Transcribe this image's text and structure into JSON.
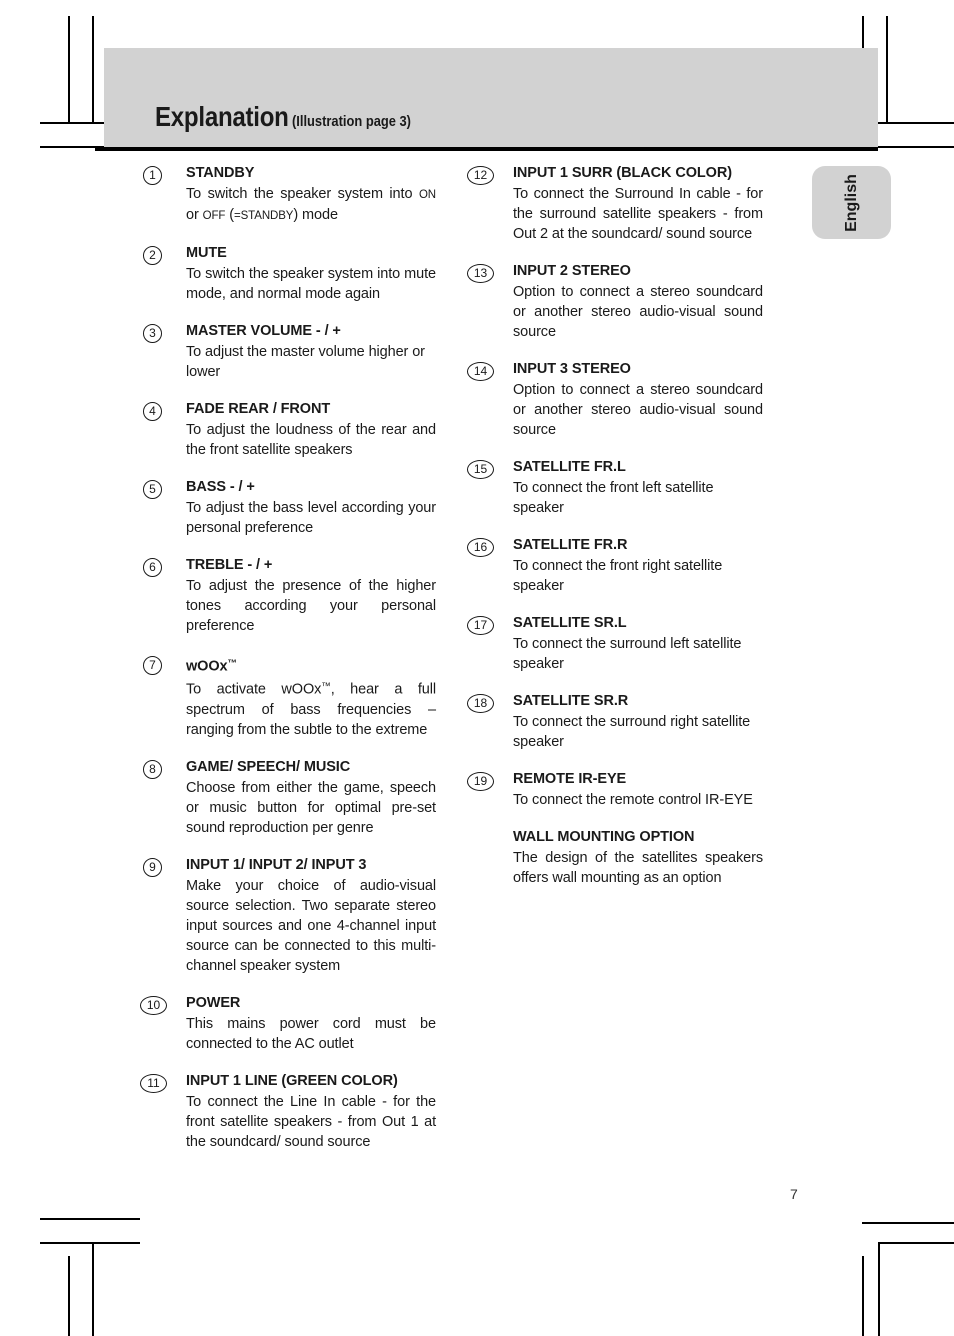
{
  "header": {
    "title": "Explanation",
    "subtitle": "(Illustration page 3)"
  },
  "language_tab": {
    "label": "English"
  },
  "page_number": "7",
  "columns": {
    "left": [
      {
        "number": "1",
        "title": "STANDBY",
        "body": "To switch the speaker system into ON or OFF (=STANDBY) mode"
      },
      {
        "number": "2",
        "title": "MUTE",
        "body": "To switch the speaker system into mute mode, and normal mode again"
      },
      {
        "number": "3",
        "title": "MASTER VOLUME - / +",
        "body": "To adjust the master volume higher or lower"
      },
      {
        "number": "4",
        "title": "FADE REAR / FRONT",
        "body": "To adjust the loudness of the rear and the front satellite speakers"
      },
      {
        "number": "5",
        "title": "BASS - / +",
        "body": "To adjust the bass level according your personal preference"
      },
      {
        "number": "6",
        "title": "TREBLE - / +",
        "body": "To adjust the presence of the higher tones according your personal preference"
      },
      {
        "number": "7",
        "title": "wOOx™",
        "body": "To activate wOOx™, hear a full spectrum of bass frequencies – ranging from the subtle to the extreme"
      },
      {
        "number": "8",
        "title": "GAME/ SPEECH/ MUSIC",
        "body": "Choose from either the game, speech or music button for optimal pre-set sound reproduction per genre"
      },
      {
        "number": "9",
        "title": "INPUT 1/ INPUT 2/ INPUT 3",
        "body": "Make your choice of audio-visual source selection. Two separate stereo input sources and one 4-channel input source can be connected to this multi-channel speaker system"
      },
      {
        "number": "10",
        "title": "POWER",
        "body": "This mains power cord must be connected to the AC outlet"
      },
      {
        "number": "11",
        "title": "INPUT 1 LINE (GREEN COLOR)",
        "body": "To connect the Line In cable - for the front satellite speakers - from Out 1 at the soundcard/ sound source"
      }
    ],
    "right": [
      {
        "number": "12",
        "title": "INPUT 1 SURR (BLACK COLOR)",
        "body": "To connect the Surround In cable - for the surround satellite speakers - from Out 2 at the soundcard/ sound source"
      },
      {
        "number": "13",
        "title": "INPUT 2 STEREO",
        "body": "Option to connect a stereo soundcard or another stereo audio-visual sound source"
      },
      {
        "number": "14",
        "title": "INPUT 3 STEREO",
        "body": "Option to connect a stereo soundcard or another stereo audio-visual sound source"
      },
      {
        "number": "15",
        "title": "SATELLITE FR.L",
        "body": "To connect the front left satellite speaker"
      },
      {
        "number": "16",
        "title": "SATELLITE FR.R",
        "body": "To connect the front right satellite speaker"
      },
      {
        "number": "17",
        "title": "SATELLITE SR.L",
        "body": "To connect the surround left satellite speaker"
      },
      {
        "number": "18",
        "title": "SATELLITE SR.R",
        "body": "To connect the surround right satellite speaker"
      },
      {
        "number": "19",
        "title": "REMOTE IR-EYE",
        "body": "To connect the remote control IR-EYE"
      },
      {
        "number": "",
        "title": "WALL MOUNTING OPTION",
        "body": "The design of the satellites speakers offers wall mounting as an option"
      }
    ]
  }
}
